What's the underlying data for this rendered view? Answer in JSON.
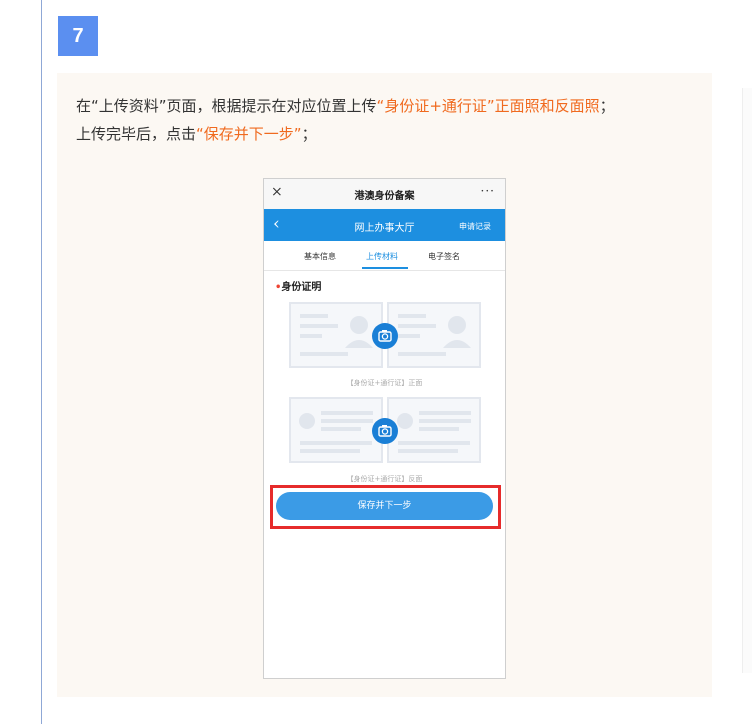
{
  "step": {
    "number": "7"
  },
  "instructions": {
    "line1_a": "在“上传资料”页面，根据提示在对应位置上传",
    "line1_highlight": "“身份证+通行证”正面照和反面照",
    "line1_end": "；",
    "line2_a": "上传完毕后，点击",
    "line2_highlight": "“保存并下一步”",
    "line2_end": "；"
  },
  "phone": {
    "top_bar": {
      "close": "×",
      "title": "港澳身份备案",
      "more": "···"
    },
    "nav_bar": {
      "back": "‹",
      "title": "网上办事大厅",
      "record_link": "申请记录"
    },
    "tabs": [
      {
        "label": "基本信息"
      },
      {
        "label": "上传材料",
        "active": true
      },
      {
        "label": "电子签名"
      }
    ],
    "section_title": "身份证明",
    "section_required_mark": "•",
    "uploads": [
      {
        "caption": "【身份证+通行证】正面"
      },
      {
        "caption": "【身份证+通行证】反面"
      }
    ],
    "save_button": "保存并下一步"
  },
  "colors": {
    "badge": "#5b8ff0",
    "highlight_text": "#f06a1f",
    "nav_blue": "#1d8fe0",
    "button_blue": "#3b9be6",
    "callout_red": "#e62b2b"
  },
  "icons": [
    "close-icon",
    "more-icon",
    "back-icon",
    "camera-icon"
  ]
}
